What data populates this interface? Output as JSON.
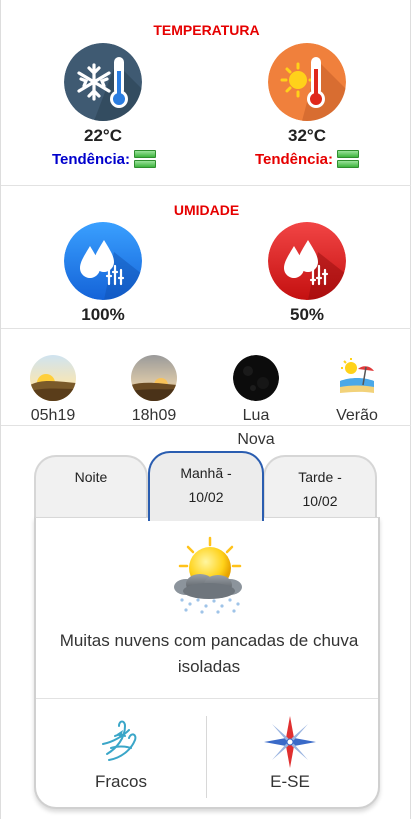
{
  "temperature": {
    "title": "TEMPERATURA",
    "min": {
      "value": "22°C",
      "trend_label": "Tendência:",
      "icon": "snowflake-thermometer-icon"
    },
    "max": {
      "value": "32°C",
      "trend_label": "Tendência:",
      "icon": "sun-thermometer-icon"
    }
  },
  "humidity": {
    "title": "UMIDADE",
    "max": {
      "value": "100%",
      "icon": "drops-high-icon"
    },
    "min": {
      "value": "50%",
      "icon": "drops-low-icon"
    }
  },
  "astro": {
    "sunrise": {
      "label": "05h19",
      "icon": "sunrise-icon"
    },
    "sunset": {
      "label": "18h09",
      "icon": "sunset-icon"
    },
    "moon": {
      "label": "Lua Nova",
      "icon": "new-moon-icon"
    },
    "season": {
      "label": "Verão",
      "icon": "beach-umbrella-icon"
    }
  },
  "forecast": {
    "tabs": [
      {
        "label": "Noite"
      },
      {
        "label": "Manhã - 10/02"
      },
      {
        "label": "Tarde - 10/02"
      }
    ],
    "active_tab": 1,
    "description": "Muitas nuvens com pancadas de chuva isoladas",
    "wind_strength": "Fracos",
    "wind_direction": "E-SE"
  },
  "colors": {
    "title_red": "#e60000",
    "trend_blue": "#0000cc",
    "active_tab_border": "#2a5db0"
  }
}
